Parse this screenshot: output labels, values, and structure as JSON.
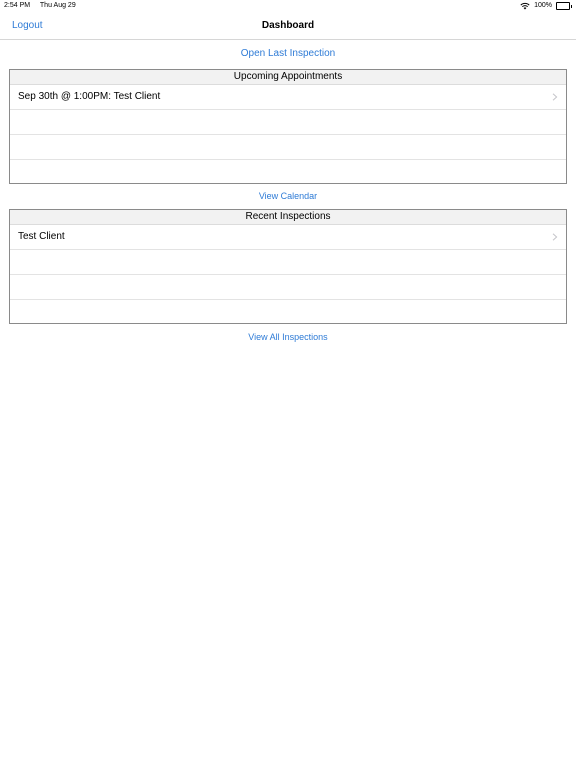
{
  "status_bar": {
    "time": "2:54 PM",
    "date": "Thu Aug 29",
    "battery": "100%"
  },
  "nav": {
    "left_button": "Logout",
    "title": "Dashboard"
  },
  "open_last_inspection": "Open Last Inspection",
  "upcoming": {
    "header": "Upcoming Appointments",
    "rows": [
      "Sep 30th @ 1:00PM: Test Client",
      "",
      "",
      ""
    ],
    "link": "View Calendar"
  },
  "recent": {
    "header": "Recent Inspections",
    "rows": [
      "Test Client",
      "",
      "",
      ""
    ],
    "link": "View All Inspections"
  },
  "colors": {
    "accent": "#2e7bd6",
    "header_bg": "#f2f2f2",
    "border": "#8a8a8a"
  },
  "icons": [
    "wifi-icon",
    "battery-icon",
    "chevron-right-icon"
  ]
}
